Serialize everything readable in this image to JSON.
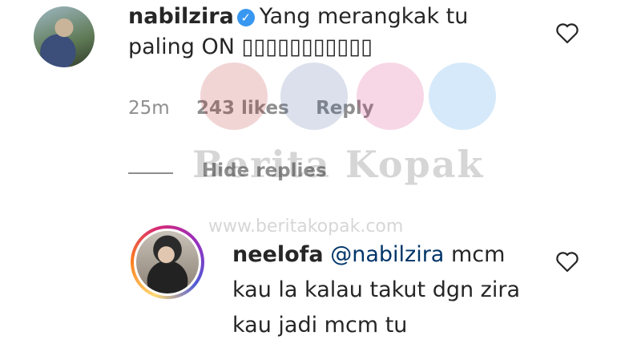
{
  "comment": {
    "username": "nabilzira",
    "text": "Yang merangkak tu paling ON ▯▯▯▯▯▯▯▯▯▯▯",
    "time": "25m",
    "likes": "243 likes",
    "reply_label": "Reply",
    "hide_replies_label": "Hide replies"
  },
  "reply": {
    "username": "neelofa",
    "mention": "@nabilzira",
    "text": "mcm kau la kalau takut dgn zira kau jadi mcm tu"
  },
  "watermark": {
    "title": "Berita Kopak",
    "url": "www.beritakopak.com"
  },
  "icons": {
    "verified": "verified-check-icon",
    "like": "heart-outline-icon"
  },
  "colors": {
    "verified": "#3897f0",
    "mention": "#003569",
    "meta": "#8e8e8e",
    "text": "#262626"
  }
}
